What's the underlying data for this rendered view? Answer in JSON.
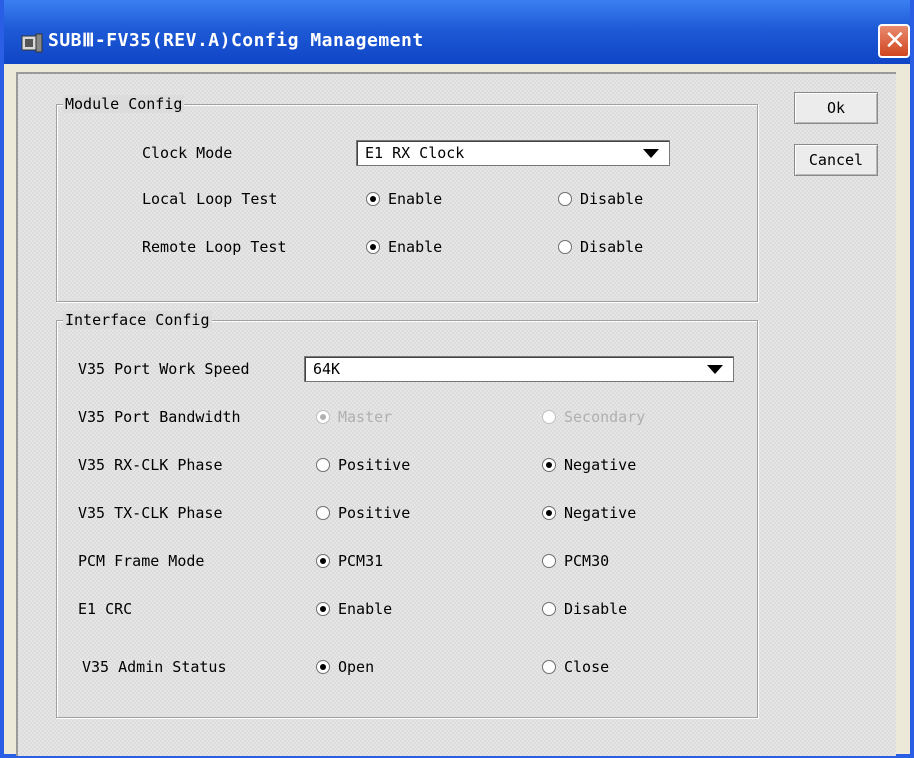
{
  "window": {
    "title": "SUBⅢ-FV35(REV.A)Config Management"
  },
  "buttons": {
    "ok": "Ok",
    "cancel": "Cancel"
  },
  "module_config": {
    "label": "Module Config",
    "clock_mode": {
      "label": "Clock Mode",
      "value": "E1 RX Clock"
    },
    "local_loop": {
      "label": "Local Loop Test",
      "opt1": "Enable",
      "opt2": "Disable",
      "selected": "Enable"
    },
    "remote_loop": {
      "label": "Remote Loop Test",
      "opt1": "Enable",
      "opt2": "Disable",
      "selected": "Enable"
    }
  },
  "interface_config": {
    "label": "Interface Config",
    "speed": {
      "label": "V35 Port Work Speed",
      "value": "64K"
    },
    "bandwidth": {
      "label": "V35 Port Bandwidth",
      "opt1": "Master",
      "opt2": "Secondary",
      "selected": "Master",
      "disabled": true
    },
    "rx_clk": {
      "label": "V35 RX-CLK Phase",
      "opt1": "Positive",
      "opt2": "Negative",
      "selected": "Negative"
    },
    "tx_clk": {
      "label": "V35 TX-CLK Phase",
      "opt1": "Positive",
      "opt2": "Negative",
      "selected": "Negative"
    },
    "pcm": {
      "label": "PCM Frame Mode",
      "opt1": "PCM31",
      "opt2": "PCM30",
      "selected": "PCM31"
    },
    "crc": {
      "label": "E1 CRC",
      "opt1": "Enable",
      "opt2": "Disable",
      "selected": "Enable"
    },
    "admin": {
      "label": "V35 Admin Status",
      "opt1": "Open",
      "opt2": "Close",
      "selected": "Open"
    }
  }
}
